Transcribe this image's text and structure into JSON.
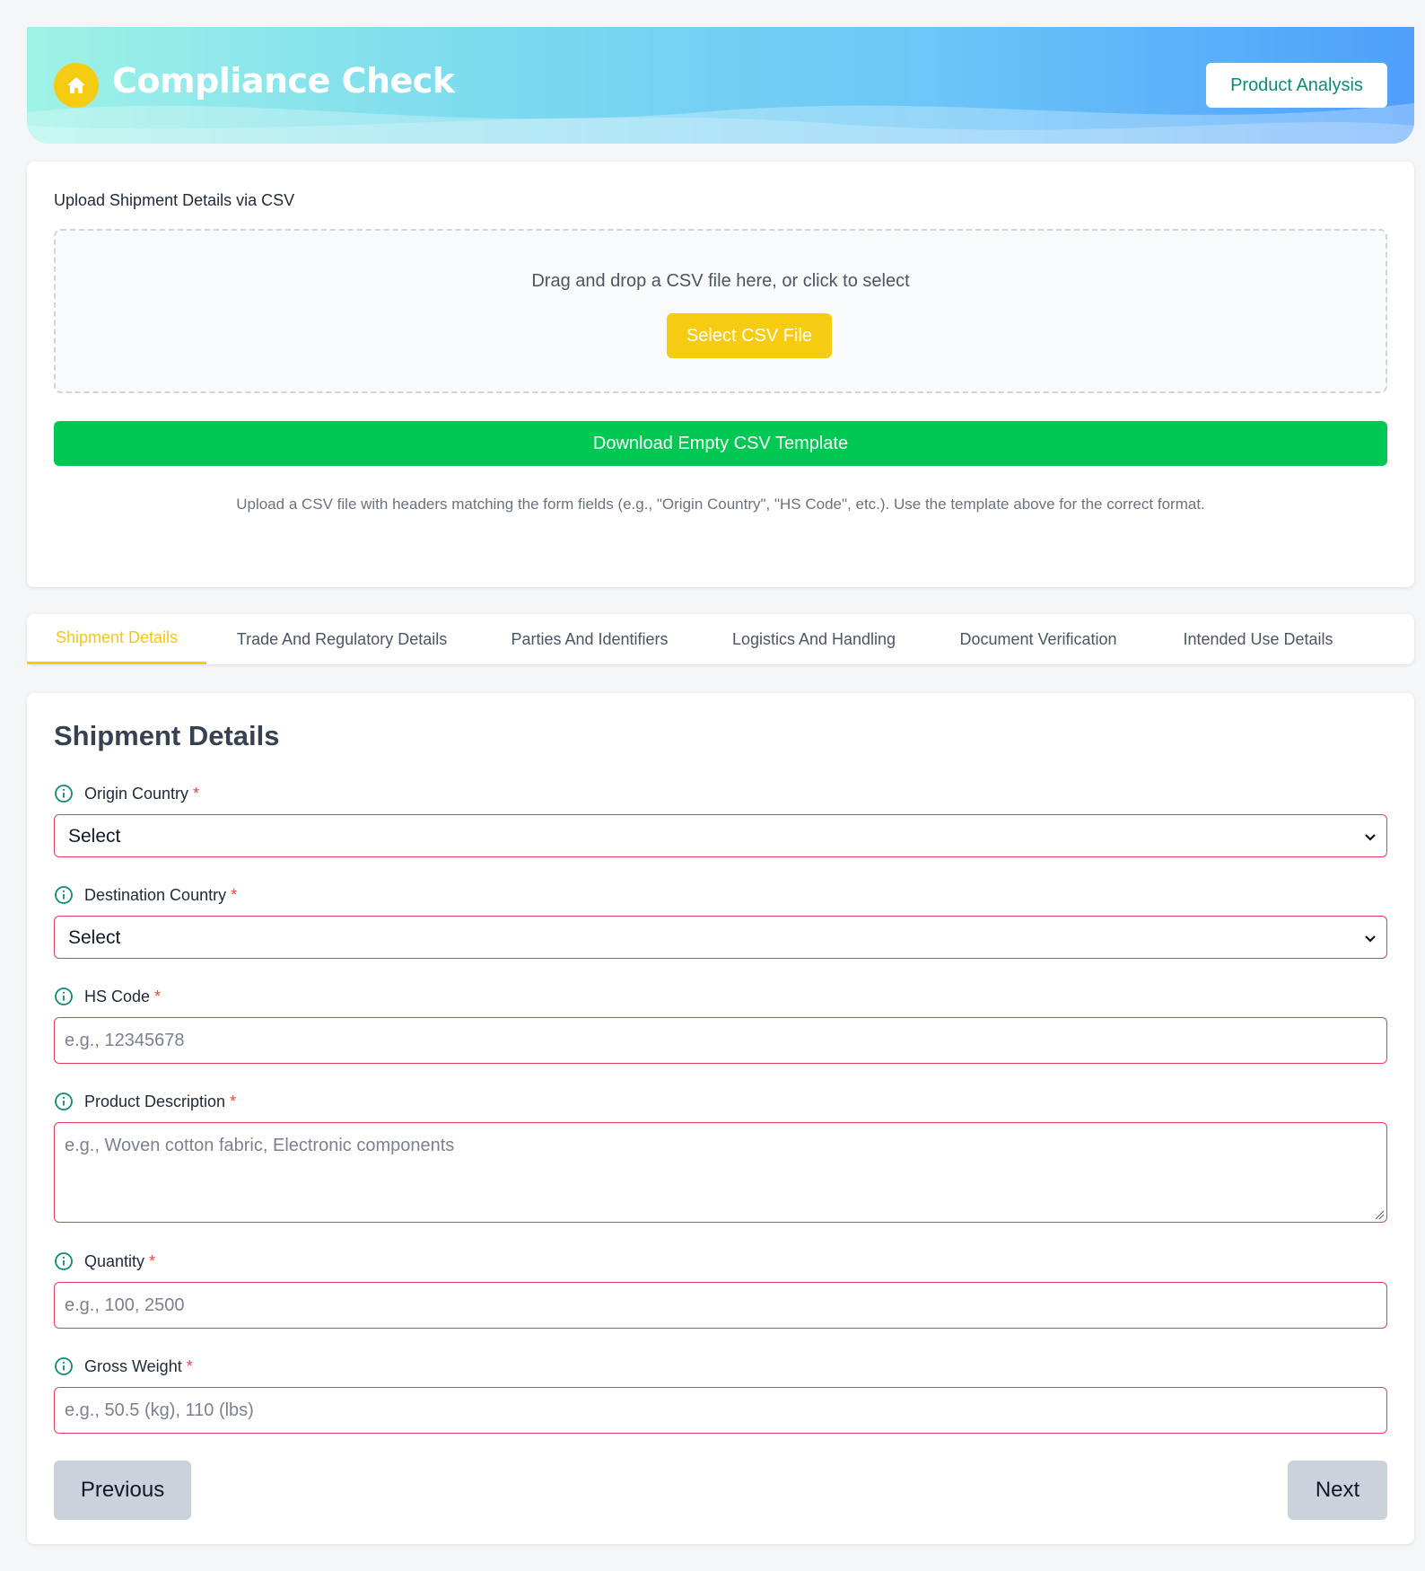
{
  "header": {
    "title": "Compliance Check",
    "product_analysis_label": "Product Analysis",
    "home_icon": "home-icon"
  },
  "upload": {
    "label": "Upload Shipment Details via CSV",
    "dropzone_text": "Drag and drop a CSV file here, or click to select",
    "select_button": "Select CSV File",
    "download_button": "Download Empty CSV Template",
    "help_text": "Upload a CSV file with headers matching the form fields (e.g., \"Origin Country\", \"HS Code\", etc.). Use the template above for the correct format."
  },
  "tabs": [
    {
      "label": "Shipment Details",
      "active": true
    },
    {
      "label": "Trade And Regulatory Details",
      "active": false
    },
    {
      "label": "Parties And Identifiers",
      "active": false
    },
    {
      "label": "Logistics And Handling",
      "active": false
    },
    {
      "label": "Document Verification",
      "active": false
    },
    {
      "label": "Intended Use Details",
      "active": false
    }
  ],
  "form": {
    "title": "Shipment Details",
    "required_marker": "*",
    "fields": [
      {
        "label": "Origin Country",
        "type": "select",
        "value": "Select"
      },
      {
        "label": "Destination Country",
        "type": "select",
        "value": "Select"
      },
      {
        "label": "HS Code",
        "type": "text",
        "placeholder": "e.g., 12345678"
      },
      {
        "label": "Product Description",
        "type": "textarea",
        "placeholder": "e.g., Woven cotton fabric, Electronic components"
      },
      {
        "label": "Quantity",
        "type": "text",
        "placeholder": "e.g., 100, 2500"
      },
      {
        "label": "Gross Weight",
        "type": "text",
        "placeholder": "e.g., 50.5 (kg), 110 (lbs)"
      }
    ],
    "previous_label": "Previous",
    "next_label": "Next"
  },
  "colors": {
    "accent_yellow": "#f5cc12",
    "download_green": "#00c853",
    "brand_teal": "#0f8a76",
    "error_border": "#e53e5a",
    "required_red": "#ef4444",
    "button_gray": "#cbd2db"
  }
}
